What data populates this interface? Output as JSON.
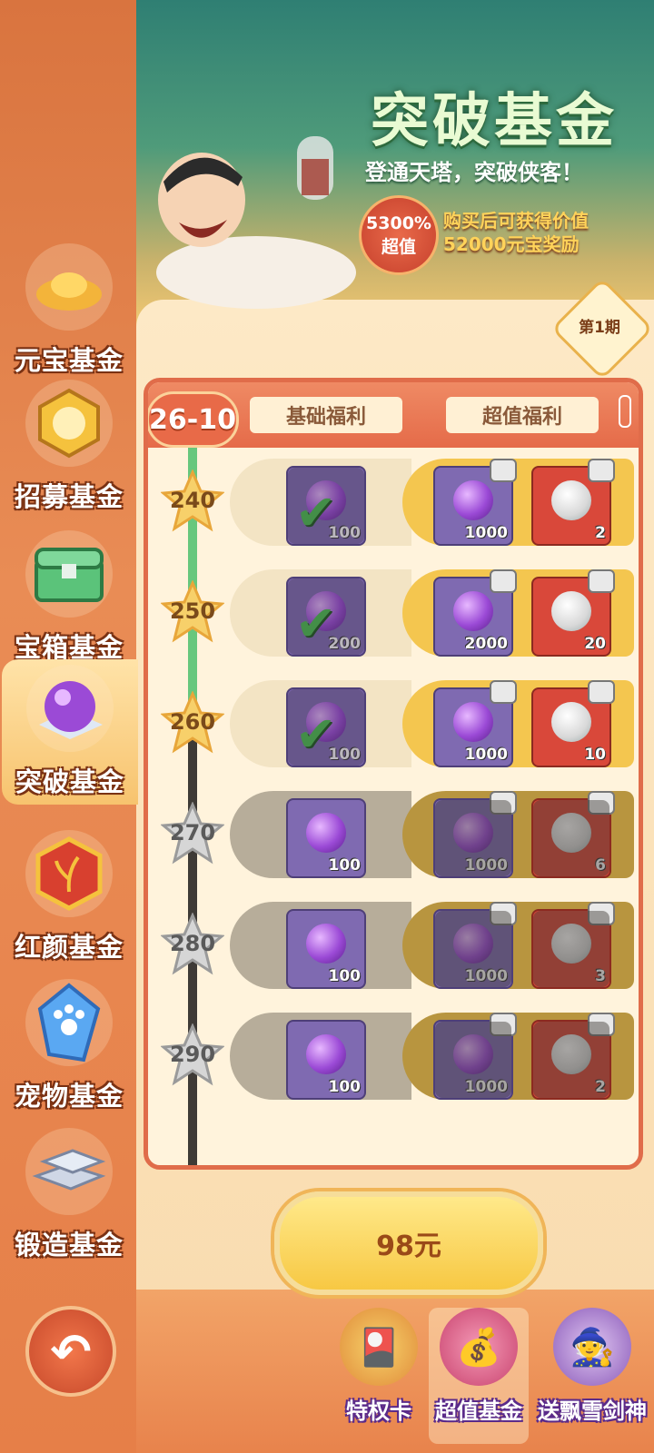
{
  "banner": {
    "title": "突破基金",
    "subtitle": "登通天塔，突破侠客！",
    "badge_line1": "5300%",
    "badge_line2": "超值",
    "desc_line1": "购买后可获得价值",
    "desc_line2": "52000元宝奖励",
    "period": "第1期"
  },
  "sidebar": {
    "items": [
      {
        "label": "元宝基金",
        "icon": "gold-ingot-icon"
      },
      {
        "label": "招募基金",
        "icon": "recruit-medal-icon"
      },
      {
        "label": "宝箱基金",
        "icon": "chest-icon"
      },
      {
        "label": "突破基金",
        "icon": "purple-orb-icon",
        "active": true
      },
      {
        "label": "红颜基金",
        "icon": "flower-badge-icon"
      },
      {
        "label": "宠物基金",
        "icon": "paw-crystal-icon"
      },
      {
        "label": "锻造基金",
        "icon": "silver-bars-icon"
      }
    ]
  },
  "panel": {
    "range": "26-10",
    "tab_basic": "基础福利",
    "tab_super": "超值福利",
    "rows": [
      {
        "level": "240",
        "base_qty": "100",
        "super_qty": "1000",
        "extra_qty": "2",
        "claimed": true,
        "locked": false
      },
      {
        "level": "250",
        "base_qty": "200",
        "super_qty": "2000",
        "extra_qty": "20",
        "claimed": true,
        "locked": false
      },
      {
        "level": "260",
        "base_qty": "100",
        "super_qty": "1000",
        "extra_qty": "10",
        "claimed": true,
        "locked": false
      },
      {
        "level": "270",
        "base_qty": "100",
        "super_qty": "1000",
        "extra_qty": "6",
        "claimed": false,
        "locked": true
      },
      {
        "level": "280",
        "base_qty": "100",
        "super_qty": "1000",
        "extra_qty": "3",
        "claimed": false,
        "locked": true
      },
      {
        "level": "290",
        "base_qty": "100",
        "super_qty": "1000",
        "extra_qty": "2",
        "claimed": false,
        "locked": true
      }
    ]
  },
  "buy_button": {
    "label": "98元"
  },
  "bottom_nav": {
    "items": [
      {
        "label": "特权卡",
        "icon": "privilege-card-icon"
      },
      {
        "label": "超值基金",
        "icon": "treasure-bag-icon",
        "active": true
      },
      {
        "label": "送飘雪剑神",
        "icon": "hero-portrait-icon"
      }
    ]
  },
  "colors": {
    "accent": "#e56b49",
    "gold": "#f4c64f",
    "claimed": "#48c14a"
  }
}
